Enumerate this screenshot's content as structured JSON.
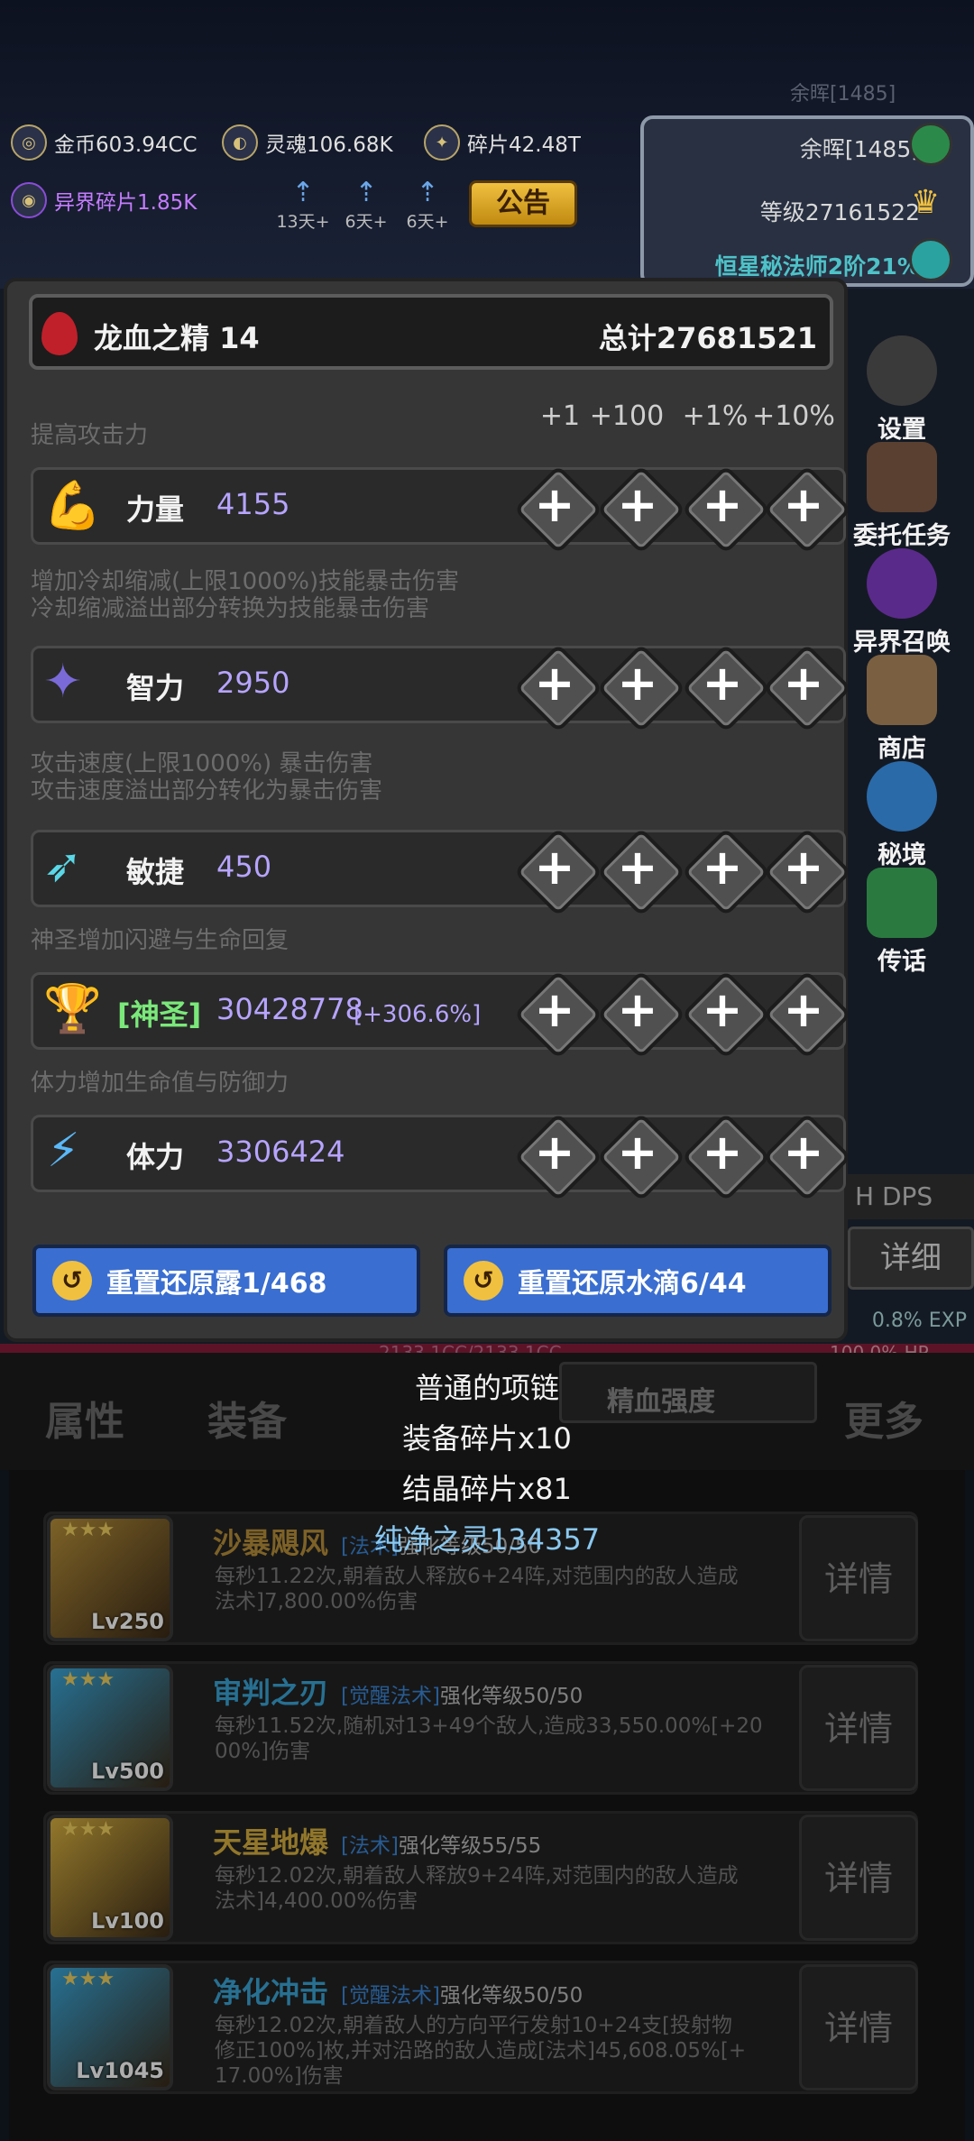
{
  "top": {
    "ghost_text": "余晖[1485]",
    "resources": {
      "gold": "金币603.94CC",
      "soul": "灵魂106.68K",
      "shard": "碎片42.48T",
      "other_shard": "异界碎片1.85K"
    },
    "timers": [
      "13天+",
      "6天+",
      "6天+"
    ],
    "notice_button": "公告",
    "panel": {
      "afterglow": "余晖[1485]",
      "level": "等级27161522",
      "rank": "恒星秘法师2阶21%"
    }
  },
  "side_menu": [
    "设置",
    "委托任务",
    "异界召唤",
    "商店",
    "秘境",
    "传话"
  ],
  "modal": {
    "header_item": "龙血之精 14",
    "header_total": "总计27681521",
    "increments": [
      "+1",
      "+100",
      "+1%",
      "+10%"
    ],
    "stats": [
      {
        "desc": [
          "提高攻击力"
        ],
        "name": "力量",
        "value": "4155",
        "extra": ""
      },
      {
        "desc": [
          "增加冷却缩减(上限1000%)技能暴击伤害",
          "冷却缩减溢出部分转换为技能暴击伤害"
        ],
        "name": "智力",
        "value": "2950",
        "extra": ""
      },
      {
        "desc": [
          "攻击速度(上限1000%) 暴击伤害",
          "攻击速度溢出部分转化为暴击伤害"
        ],
        "name": "敏捷",
        "value": "450",
        "extra": ""
      },
      {
        "desc": [
          "神圣增加闪避与生命回复"
        ],
        "name": "[神圣]",
        "value": "30428778",
        "extra": "[+306.6%]"
      },
      {
        "desc": [
          "体力增加生命值与防御力"
        ],
        "name": "体力",
        "value": "3306424",
        "extra": ""
      }
    ],
    "reset_buttons": [
      "重置还原露1/468",
      "重置还原水滴6/44"
    ]
  },
  "behind_modal": {
    "dps_label": "H DPS",
    "detail_label": "详细",
    "exp": "0.8% EXP",
    "hp": "100.0% HP",
    "hp_text": "2133.1CC/2133.1CC"
  },
  "drops": [
    "普通的项链",
    "装备碎片x10",
    "结晶碎片x81",
    "纯净之灵134357"
  ],
  "tabs": [
    "属性",
    "装备",
    "精血强度",
    "更多"
  ],
  "skills": [
    {
      "name": "沙暴飓风",
      "tag": "[法术]",
      "level_text": "强化等级50/50",
      "lv": "Lv250",
      "desc1": "每秒11.22次,朝着敌人释放6+24阵,对范围内的敌人造成",
      "desc2": "法术]7,800.00%伤害",
      "color": "#b8903a"
    },
    {
      "name": "审判之刃",
      "tag": "[觉醒法术]",
      "level_text": "强化等级50/50",
      "lv": "Lv500",
      "desc1": "每秒11.52次,随机对13+49个敌人,造成33,550.00%[+20",
      "desc2": "00%]伤害",
      "color": "#3aa6d8"
    },
    {
      "name": "天星地爆",
      "tag": "[法术]",
      "level_text": "强化等级55/55",
      "lv": "Lv100",
      "desc1": "每秒12.02次,朝着敌人释放9+24阵,对范围内的敌人造成",
      "desc2": "法术]4,400.00%伤害",
      "color": "#d8b040"
    },
    {
      "name": "净化冲击",
      "tag": "[觉醒法术]",
      "level_text": "强化等级50/50",
      "lv": "Lv1045",
      "desc1": "每秒12.02次,朝着敌人的方向平行发射10+24支[投射物",
      "desc2": "修正100%]枚,并对沿路的敌人造成[法术]45,608.05%[+",
      "desc3": "17.00%]伤害",
      "color": "#3aa6d8"
    }
  ],
  "detail_button": "详情"
}
